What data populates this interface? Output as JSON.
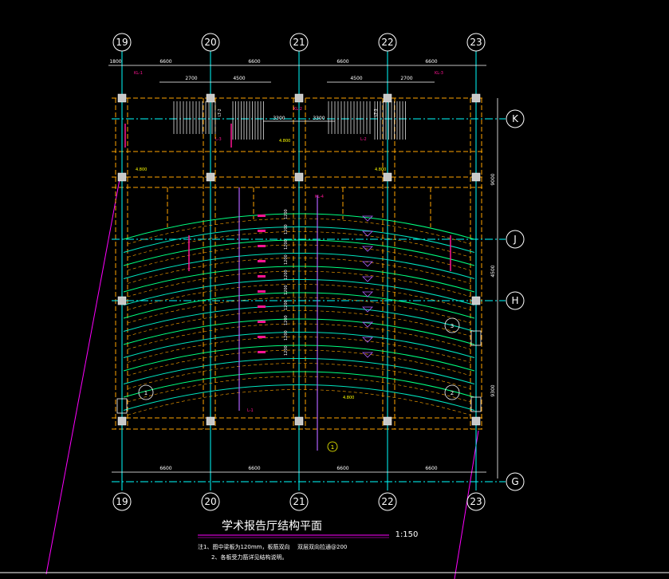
{
  "drawing": {
    "title": "学术报告厅结构平面",
    "scale": "1:150",
    "notes": [
      "注1、图中梁板为120mm，板筋双向",
      "2、各板受力筋详见结构说明。",
      "双层双向拉通@200"
    ],
    "colors": {
      "background": "#000000",
      "axis": "#00ffff",
      "beam_dashed": "#ffa500",
      "slab_curve": "#00ff7f",
      "annotation": "#ff1493",
      "dimension": "#ffffff",
      "column": "#c8c8c8",
      "title": "#ffffff",
      "leader": "#ff00ff",
      "elevation": "#ffff00"
    }
  },
  "axes": {
    "vertical": [
      "19",
      "20",
      "21",
      "22",
      "23"
    ],
    "horizontal": [
      "K",
      "J",
      "H",
      "G"
    ]
  },
  "dimensions": {
    "top_spans": [
      "6600",
      "6600",
      "6600",
      "6600"
    ],
    "bottom_spans": [
      "6600",
      "6600",
      "6600",
      "6600"
    ],
    "top_edge": "1800",
    "stair_left": [
      "2700",
      "4500"
    ],
    "stair_right": [
      "4500",
      "2700"
    ],
    "center_dims": [
      "3300",
      "3300"
    ],
    "right_spans": [
      "9000",
      "4500",
      "9300"
    ],
    "row_dims": [
      "1200",
      "1200",
      "1200",
      "1200",
      "1200",
      "1200",
      "1200",
      "1200",
      "1200",
      "1200"
    ]
  },
  "labels": {
    "stair_left": "LT-2",
    "stair_right": "LT-3",
    "beam_tags": [
      "KL-1",
      "KL-2",
      "KL-3",
      "KL-4",
      "L-1",
      "L-2",
      "L-3"
    ],
    "slab_mark": "1",
    "detail_marks": [
      "1",
      "2",
      "3",
      "4"
    ],
    "elevations": [
      "4.800",
      "4.800",
      "4.800",
      "4.800"
    ]
  }
}
